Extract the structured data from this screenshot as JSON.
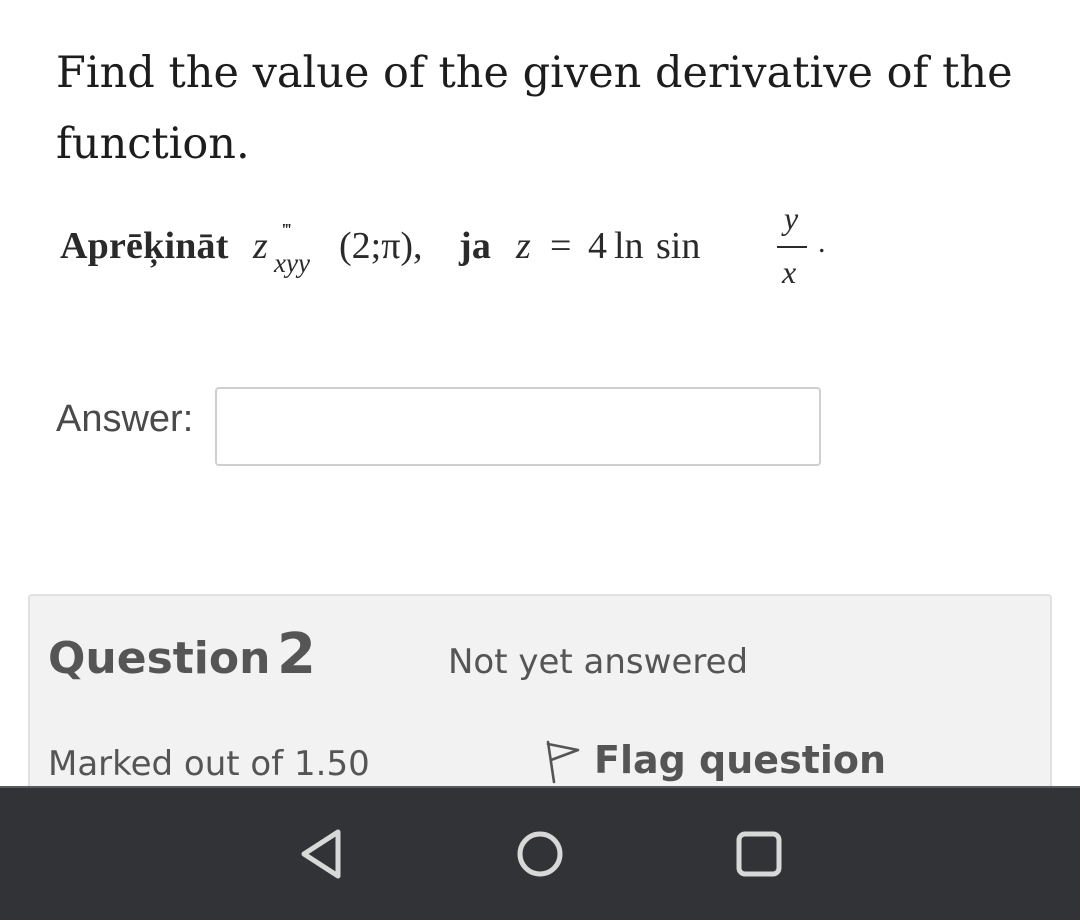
{
  "question": {
    "text": "Find the value of the given derivative of the function.",
    "formula": {
      "prefix": "Aprēķināt",
      "var": "z",
      "primes": "‴",
      "subscript": "xyy",
      "point": "(2;π),",
      "conj": "ja",
      "lhs": "z",
      "equals": "=",
      "coef": "4",
      "ln": "ln",
      "sin": "sin",
      "numerator": "y",
      "denominator": "x",
      "period": "."
    }
  },
  "answer": {
    "label": "Answer:",
    "value": ""
  },
  "info": {
    "question_word": "Question",
    "question_number": "2",
    "state": "Not yet answered",
    "grade": "Marked out of 1.50",
    "flag_label": "Flag question"
  },
  "navbar": {
    "buttons": [
      "back-icon",
      "home-icon",
      "recents-icon"
    ],
    "background": "#323337"
  }
}
